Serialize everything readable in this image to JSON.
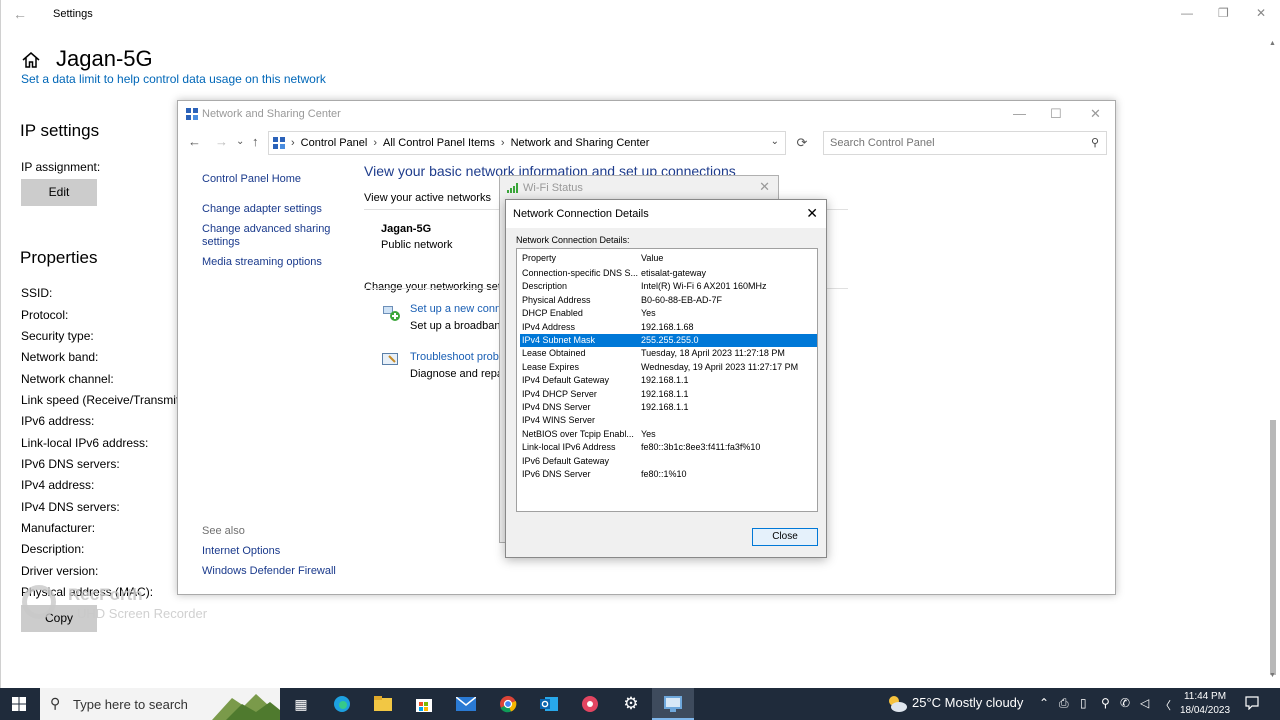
{
  "settings": {
    "back_icon": "arrow-left-icon",
    "title": "Settings",
    "controls": [
      "—",
      "❐",
      "✕"
    ],
    "network_name": "Jagan-5G",
    "data_limit_link": "Set a data limit to help control data usage on this network",
    "ip_settings_heading": "IP settings",
    "ip_assignment_label": "IP assignment:",
    "edit_button": "Edit",
    "properties_heading": "Properties",
    "property_labels": [
      "SSID:",
      "Protocol:",
      "Security type:",
      "Network band:",
      "Network channel:",
      "Link speed (Receive/Transmit):",
      "IPv6 address:",
      "Link-local IPv6 address:",
      "IPv6 DNS servers:",
      "IPv4 address:",
      "IPv4 DNS servers:",
      "Manufacturer:",
      "Description:",
      "Driver version:",
      "Physical address (MAC):"
    ],
    "mac_value_partial": "B0-60-88-EB-AD-7F",
    "copy_button": "Copy"
  },
  "watermark": {
    "line1": "RecForth",
    "line2": "UHD Screen Recorder"
  },
  "nsc": {
    "title": "Network and Sharing Center",
    "controls": [
      "—",
      "☐",
      "✕"
    ],
    "nav": [
      "←",
      "→",
      "⌄",
      "↑"
    ],
    "breadcrumbs": [
      "Control Panel",
      "All Control Panel Items",
      "Network and Sharing Center"
    ],
    "crumb_sep": "›",
    "refresh_icon": "⟳",
    "search_placeholder": "Search Control Panel",
    "sidebar": {
      "home": "Control Panel Home",
      "adapter": "Change adapter settings",
      "advanced_1": "Change advanced sharing",
      "advanced_2": "settings",
      "media": "Media streaming options",
      "see_also": "See also",
      "internet_options": "Internet Options",
      "firewall": "Windows Defender Firewall"
    },
    "main_title": "View your basic network information and set up connections",
    "active_networks_label": "View your active networks",
    "network_name": "Jagan-5G",
    "network_type": "Public network",
    "change_settings_label": "Change your networking settings",
    "setup_link": "Set up a new connection or network",
    "setup_desc": "Set up a broadband, dial-up, or VPN connection; or set up a router or access point.",
    "troubleshoot_link": "Troubleshoot problems",
    "troubleshoot_desc": "Diagnose and repair network problems, or get troubleshooting information."
  },
  "wifi_status": {
    "title": "Wi-Fi Status",
    "close": "✕"
  },
  "details": {
    "title": "Network Connection Details",
    "close": "✕",
    "label": "Network Connection Details:",
    "col_property": "Property",
    "col_value": "Value",
    "rows": [
      {
        "property": "Connection-specific DNS S...",
        "value": "etisalat-gateway"
      },
      {
        "property": "Description",
        "value": "Intel(R) Wi-Fi 6 AX201 160MHz"
      },
      {
        "property": "Physical Address",
        "value": "B0-60-88-EB-AD-7F"
      },
      {
        "property": "DHCP Enabled",
        "value": "Yes"
      },
      {
        "property": "IPv4 Address",
        "value": "192.168.1.68"
      },
      {
        "property": "IPv4 Subnet Mask",
        "value": "255.255.255.0"
      },
      {
        "property": "Lease Obtained",
        "value": "Tuesday, 18 April 2023 11:27:18 PM"
      },
      {
        "property": "Lease Expires",
        "value": "Wednesday, 19 April 2023 11:27:17 PM"
      },
      {
        "property": "IPv4 Default Gateway",
        "value": "192.168.1.1"
      },
      {
        "property": "IPv4 DHCP Server",
        "value": "192.168.1.1"
      },
      {
        "property": "IPv4 DNS Server",
        "value": "192.168.1.1"
      },
      {
        "property": "IPv4 WINS Server",
        "value": ""
      },
      {
        "property": "NetBIOS over Tcpip Enabl...",
        "value": "Yes"
      },
      {
        "property": "Link-local IPv6 Address",
        "value": "fe80::3b1c:8ee3:f411:fa3f%10"
      },
      {
        "property": "IPv6 Default Gateway",
        "value": ""
      },
      {
        "property": "IPv6 DNS Server",
        "value": "fe80::1%10"
      }
    ],
    "selected_index": 5,
    "close_button": "Close"
  },
  "taskbar": {
    "search_placeholder": "Type here to search",
    "weather": "25°C  Mostly cloudy",
    "time": "11:44 PM",
    "date": "18/04/2023",
    "tray_icons": [
      "⌃",
      "⎙",
      "▯",
      "⚲",
      "✆",
      "◁"
    ]
  },
  "colors": {
    "accent": "#0078d7",
    "link": "#0067b8",
    "taskbar": "#1f2b3b",
    "selection": "#0078d7"
  }
}
